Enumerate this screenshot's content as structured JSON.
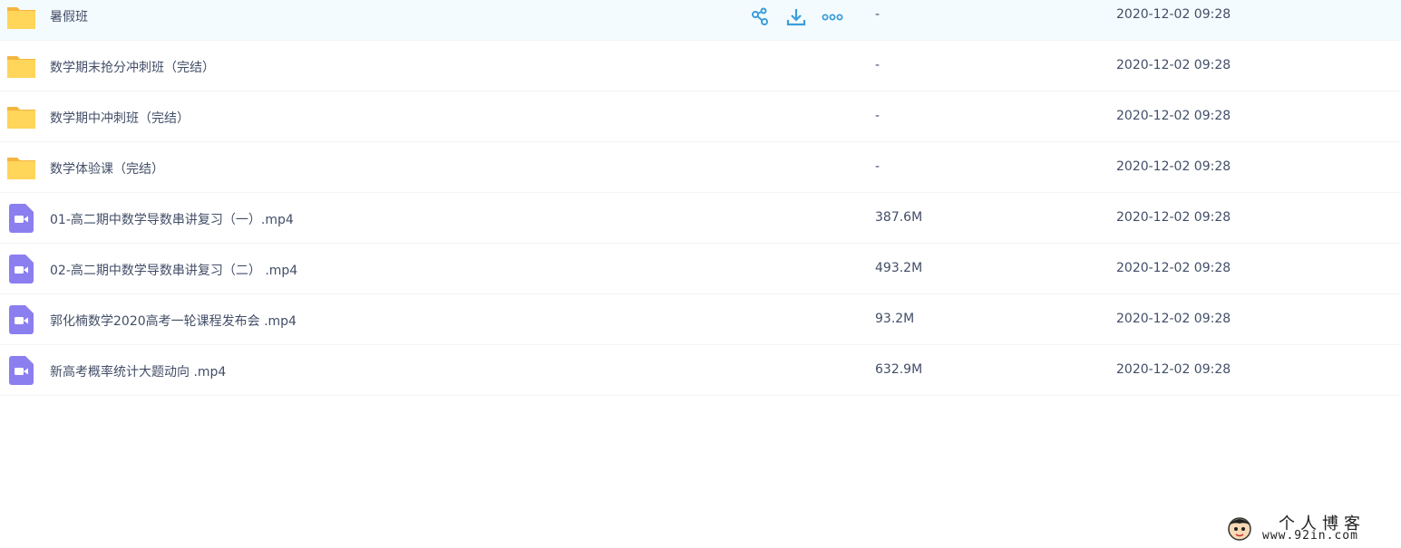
{
  "file_list": {
    "rows": [
      {
        "name": "暑假班",
        "type": "folder",
        "size": "-",
        "date": "2020-12-02 09:28"
      },
      {
        "name": "数学期末抢分冲刺班（完结）",
        "type": "folder",
        "size": "-",
        "date": "2020-12-02 09:28"
      },
      {
        "name": "数学期中冲刺班（完结）",
        "type": "folder",
        "size": "-",
        "date": "2020-12-02 09:28"
      },
      {
        "name": "数学体验课（完结）",
        "type": "folder",
        "size": "-",
        "date": "2020-12-02 09:28"
      },
      {
        "name": "01-高二期中数学导数串讲复习（一）.mp4",
        "type": "video",
        "size": "387.6M",
        "date": "2020-12-02 09:28"
      },
      {
        "name": "02-高二期中数学导数串讲复习（二） .mp4",
        "type": "video",
        "size": "493.2M",
        "date": "2020-12-02 09:28"
      },
      {
        "name": "郭化楠数学2020高考一轮课程发布会 .mp4",
        "type": "video",
        "size": "93.2M",
        "date": "2020-12-02 09:28"
      },
      {
        "name": "新高考概率统计大题动向 .mp4",
        "type": "video",
        "size": "632.9M",
        "date": "2020-12-02 09:28"
      }
    ],
    "hover_actions": [
      "share-icon",
      "download-icon",
      "more-icon"
    ]
  },
  "colors": {
    "folder": "#ffd55a",
    "folder_tab": "#f4b63f",
    "video": "#8b7ff0",
    "action": "#3b9ddb",
    "hover_bg": "#f4fbfe"
  },
  "watermark": {
    "title": "个人博客",
    "url": "www.92in.com"
  }
}
